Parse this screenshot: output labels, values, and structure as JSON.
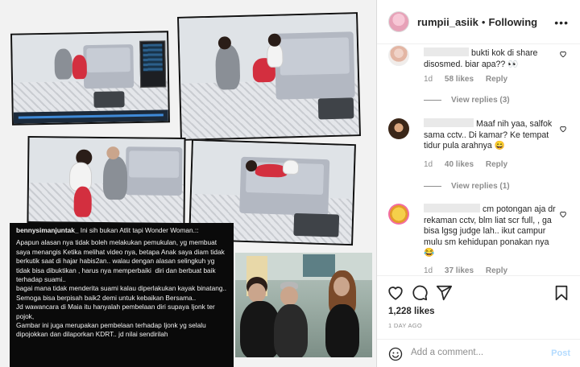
{
  "post": {
    "username": "rumpii_asiik",
    "separator": "•",
    "follow_status": "Following",
    "more": "•••"
  },
  "caption": {
    "username": "bennysimanjuntak_",
    "headline": " Ini sih bukan Atlit tapi Wonder Woman.::",
    "lines": [
      "Apapun alasan nya tidak boleh melakukan pemukulan, yg membuat saya menangis Ketika melihat video nya, betapa Anak saya diam tidak berkutik saat di hajar habis2an.. walau dengan alasan selingkuh yg tidak bisa dibuktikan , harus nya memperbaiki  diri dan berbuat baik terhadap suami..",
      "bagai mana tidak menderita suami kalau diperlakukan kayak binatang..",
      "Semoga bisa berpisah baik2 demi untuk kebaikan Bersama..",
      "Jd wawancara di Maia itu hanyalah pembelaan diri supaya Ijonk ter pojok,",
      "Gambar ini juga merupakan pembelaan terhadap Ijonk yg selalu dipojokkan dan dilaporkan KDRT.. jd nilai sendirilah"
    ]
  },
  "comments": [
    {
      "text": "bukti kok di share disosmed. biar apa??",
      "emoji": "👀",
      "age": "1d",
      "likes": "58 likes",
      "reply_label": "Reply",
      "view_replies": "View replies (3)"
    },
    {
      "text": "Maaf nih yaa, salfok sama cctv.. Di kamar? Ke tempat tidur pula arahnya",
      "emoji": "😄",
      "age": "1d",
      "likes": "40 likes",
      "reply_label": "Reply",
      "view_replies": "View replies (1)"
    },
    {
      "text": "cm potongan aja dr rekaman cctv, blm liat scr full, , ga bisa lgsg judge lah.. ikut campur mulu sm kehidupan ponakan nya",
      "emoji": "😂",
      "age": "1d",
      "likes": "37 likes",
      "reply_label": "Reply"
    }
  ],
  "actions": {
    "likes": "1,228 likes",
    "time_ago": "1 DAY AGO"
  },
  "add_comment": {
    "placeholder": "Add a comment...",
    "post_label": "Post"
  },
  "icons": {
    "heart": "heart-icon",
    "comment": "comment-icon",
    "share": "share-icon",
    "bookmark": "bookmark-icon",
    "emoji": "emoji-icon"
  },
  "colors": {
    "post_button": "#b3dbff",
    "meta_text": "#8e8e8e",
    "border": "#dbdbdb"
  }
}
